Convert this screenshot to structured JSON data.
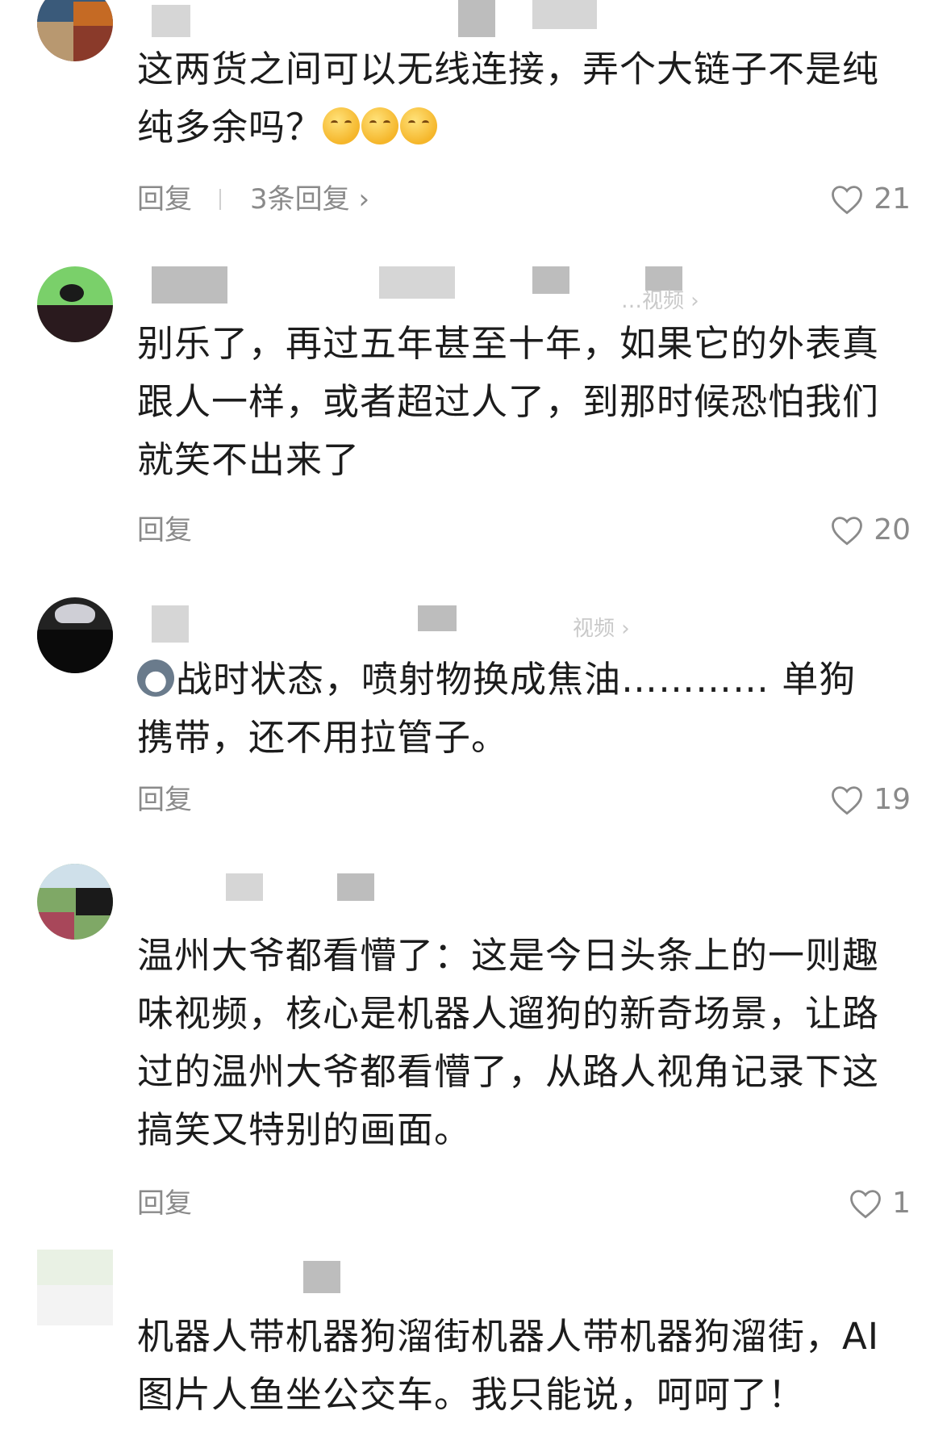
{
  "comments": [
    {
      "text_before_emoji": "这两货之间可以无线连接，弄个大链子不是纯纯多余吗？",
      "emoji": [
        "pouting-face-emoji",
        "pouting-face-emoji",
        "pouting-face-emoji"
      ],
      "reply_label": "回复",
      "replies_label": "3条回复 ›",
      "likes": "21"
    },
    {
      "faint_subtitle": "…视频 ›",
      "text": "别乐了，再过五年甚至十年，如果它的外表真跟人一样，或者超过人了，到那时候恐怕我们就笑不出来了",
      "reply_label": "回复",
      "likes": "20"
    },
    {
      "faint_subtitle": "视频 ›",
      "emoji": "husky-emoji",
      "text": "战时状态，喷射物换成焦油………… 单狗携带，还不用拉管子。",
      "reply_label": "回复",
      "likes": "19"
    },
    {
      "text": "温州大爷都看懵了：这是今日头条上的一则趣味视频，核心是机器人遛狗的新奇场景，让路过的温州大爷都看懵了，从路人视角记录下这搞笑又特别的画面。",
      "reply_label": "回复",
      "likes": "1"
    },
    {
      "text": "机器人带机器狗溜街机器人带机器狗溜街，AI图片人鱼坐公交车。我只能说，呵呵了！"
    }
  ],
  "icons": {
    "like": "heart-outline-icon",
    "chevron": "chevron-right-icon"
  },
  "colors": {
    "text_primary": "#1c1c1c",
    "text_secondary": "#8a8a8a",
    "censor": "#d6d6d6"
  }
}
